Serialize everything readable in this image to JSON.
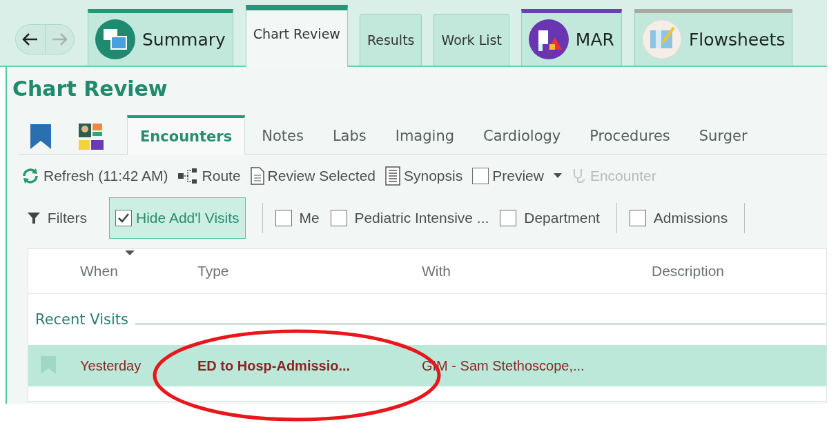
{
  "nav": {
    "back": {
      "disabled": false
    },
    "forward": {
      "disabled": true
    }
  },
  "tabs": [
    {
      "label": "Summary",
      "kind": "calendar",
      "color": "#1f9a78",
      "selected": false
    },
    {
      "label": "Chart Review",
      "kind": "text",
      "color": "#1f9a78",
      "selected": true
    },
    {
      "label": "Results",
      "kind": "text",
      "selected": false
    },
    {
      "label": "Work List",
      "kind": "text",
      "selected": false
    },
    {
      "label": "MAR",
      "kind": "ivbag",
      "color": "#6a40b8",
      "selected": false
    },
    {
      "label": "Flowsheets",
      "kind": "chart",
      "color": "#a8a8a0",
      "selected": false
    }
  ],
  "page_title": "Chart Review",
  "subtabs": [
    {
      "label": "Encounters",
      "selected": true
    },
    {
      "label": "Notes",
      "selected": false
    },
    {
      "label": "Labs",
      "selected": false
    },
    {
      "label": "Imaging",
      "selected": false
    },
    {
      "label": "Cardiology",
      "selected": false
    },
    {
      "label": "Procedures",
      "selected": false
    },
    {
      "label": "Surger",
      "selected": false
    }
  ],
  "toolbar": [
    {
      "kind": "refresh",
      "label": "Refresh (11:42 AM)",
      "disabled": false
    },
    {
      "kind": "route",
      "label": "Route",
      "disabled": false
    },
    {
      "kind": "document",
      "label": "Review Selected",
      "disabled": false
    },
    {
      "kind": "synopsis",
      "label": "Synopsis",
      "disabled": false
    },
    {
      "kind": "checkbox",
      "label": "Preview",
      "checked": false,
      "disabled": false
    },
    {
      "kind": "dropdown",
      "disabled": false
    },
    {
      "kind": "encounter",
      "label": "Encounter",
      "disabled": true
    }
  ],
  "filters": [
    {
      "kind": "filter",
      "label": "Filters"
    },
    {
      "kind": "toggle",
      "label": "Hide Add'l Visits",
      "checked": true
    },
    {
      "kind": "separator"
    },
    {
      "kind": "checkbox",
      "label": "Me",
      "checked": false
    },
    {
      "kind": "checkbox",
      "label": "Pediatric Intensive ...",
      "checked": false
    },
    {
      "kind": "checkbox",
      "label": "Department",
      "checked": false
    },
    {
      "kind": "separator"
    },
    {
      "kind": "checkbox",
      "label": "Admissions",
      "checked": false
    },
    {
      "kind": "separator"
    }
  ],
  "table": {
    "columns": [
      "When",
      "Type",
      "With",
      "Description"
    ],
    "groups": [
      {
        "title": "Recent Visits",
        "rows": [
          {
            "when": "Yesterday",
            "type": "ED to Hosp-Admissio...",
            "with": "GIM - Sam Stethoscope,...",
            "selected": true
          }
        ]
      }
    ]
  },
  "annotation": {
    "kind": "ellipse",
    "color": "#e8171b"
  }
}
